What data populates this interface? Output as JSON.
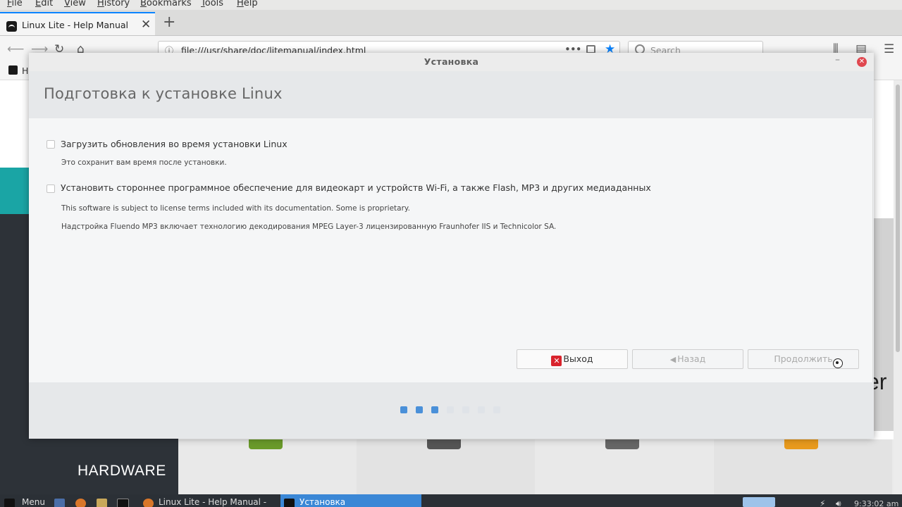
{
  "browser": {
    "menu": [
      "File",
      "Edit",
      "View",
      "History",
      "Bookmarks",
      "Tools",
      "Help"
    ],
    "tab_title": "Linux Lite - Help Manual",
    "tab_close": "✕",
    "new_tab": "+",
    "url": "file:///usr/share/doc/litemanual/index.html",
    "search_placeholder": "Search",
    "bookmark_label": "H"
  },
  "page": {
    "hardware_label": "HARDWARE",
    "right_fragment": "er"
  },
  "dialog": {
    "window_title": "Установка",
    "minimize": "–",
    "close": "✕",
    "heading": "Подготовка к установке Linux",
    "options": [
      {
        "label": "Загрузить обновления во время установки Linux",
        "checked": false,
        "descriptions": [
          "Это сохранит вам время после установки."
        ]
      },
      {
        "label": "Установить стороннее программное обеспечение для видеокарт и устройств Wi-Fi, а также Flash, MP3 и других медиаданных",
        "checked": false,
        "descriptions": [
          "This software is subject to license terms included with its documentation. Some is proprietary.",
          "Надстройка Fluendo MP3 включает технологию декодирования MPEG Layer-3 лицензированную Fraunhofer IIS и Technicolor SA."
        ]
      }
    ],
    "buttons": {
      "quit": "Выход",
      "back": "Назад",
      "next": "Продолжить"
    },
    "progress": {
      "total_steps": 7,
      "completed_steps": 3,
      "active_color": "#4a90d9",
      "inactive_color": "#dfe3e8"
    }
  },
  "taskbar": {
    "menu_label": "Menu",
    "firefox_task": "Linux Lite - Help Manual -",
    "installer_task": "Установка",
    "clock": "9:33:02 am"
  }
}
